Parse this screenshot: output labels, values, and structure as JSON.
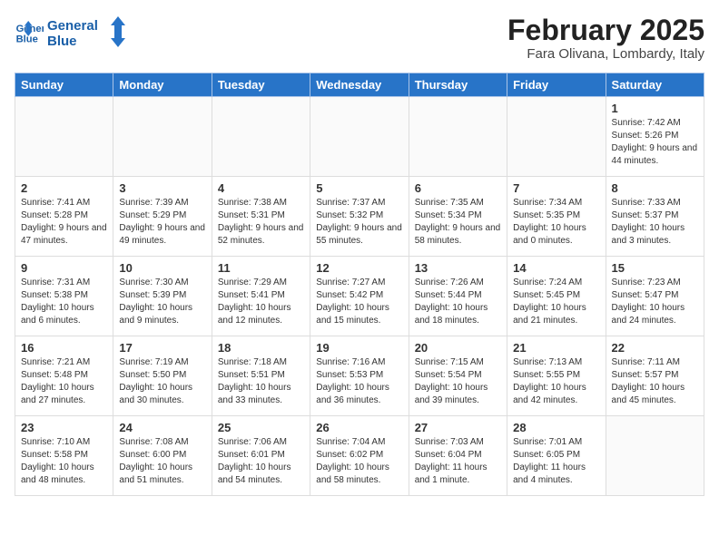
{
  "header": {
    "logo_line1": "General",
    "logo_line2": "Blue",
    "month": "February 2025",
    "location": "Fara Olivana, Lombardy, Italy"
  },
  "weekdays": [
    "Sunday",
    "Monday",
    "Tuesday",
    "Wednesday",
    "Thursday",
    "Friday",
    "Saturday"
  ],
  "weeks": [
    [
      {
        "day": "",
        "info": ""
      },
      {
        "day": "",
        "info": ""
      },
      {
        "day": "",
        "info": ""
      },
      {
        "day": "",
        "info": ""
      },
      {
        "day": "",
        "info": ""
      },
      {
        "day": "",
        "info": ""
      },
      {
        "day": "1",
        "info": "Sunrise: 7:42 AM\nSunset: 5:26 PM\nDaylight: 9 hours and 44 minutes."
      }
    ],
    [
      {
        "day": "2",
        "info": "Sunrise: 7:41 AM\nSunset: 5:28 PM\nDaylight: 9 hours and 47 minutes."
      },
      {
        "day": "3",
        "info": "Sunrise: 7:39 AM\nSunset: 5:29 PM\nDaylight: 9 hours and 49 minutes."
      },
      {
        "day": "4",
        "info": "Sunrise: 7:38 AM\nSunset: 5:31 PM\nDaylight: 9 hours and 52 minutes."
      },
      {
        "day": "5",
        "info": "Sunrise: 7:37 AM\nSunset: 5:32 PM\nDaylight: 9 hours and 55 minutes."
      },
      {
        "day": "6",
        "info": "Sunrise: 7:35 AM\nSunset: 5:34 PM\nDaylight: 9 hours and 58 minutes."
      },
      {
        "day": "7",
        "info": "Sunrise: 7:34 AM\nSunset: 5:35 PM\nDaylight: 10 hours and 0 minutes."
      },
      {
        "day": "8",
        "info": "Sunrise: 7:33 AM\nSunset: 5:37 PM\nDaylight: 10 hours and 3 minutes."
      }
    ],
    [
      {
        "day": "9",
        "info": "Sunrise: 7:31 AM\nSunset: 5:38 PM\nDaylight: 10 hours and 6 minutes."
      },
      {
        "day": "10",
        "info": "Sunrise: 7:30 AM\nSunset: 5:39 PM\nDaylight: 10 hours and 9 minutes."
      },
      {
        "day": "11",
        "info": "Sunrise: 7:29 AM\nSunset: 5:41 PM\nDaylight: 10 hours and 12 minutes."
      },
      {
        "day": "12",
        "info": "Sunrise: 7:27 AM\nSunset: 5:42 PM\nDaylight: 10 hours and 15 minutes."
      },
      {
        "day": "13",
        "info": "Sunrise: 7:26 AM\nSunset: 5:44 PM\nDaylight: 10 hours and 18 minutes."
      },
      {
        "day": "14",
        "info": "Sunrise: 7:24 AM\nSunset: 5:45 PM\nDaylight: 10 hours and 21 minutes."
      },
      {
        "day": "15",
        "info": "Sunrise: 7:23 AM\nSunset: 5:47 PM\nDaylight: 10 hours and 24 minutes."
      }
    ],
    [
      {
        "day": "16",
        "info": "Sunrise: 7:21 AM\nSunset: 5:48 PM\nDaylight: 10 hours and 27 minutes."
      },
      {
        "day": "17",
        "info": "Sunrise: 7:19 AM\nSunset: 5:50 PM\nDaylight: 10 hours and 30 minutes."
      },
      {
        "day": "18",
        "info": "Sunrise: 7:18 AM\nSunset: 5:51 PM\nDaylight: 10 hours and 33 minutes."
      },
      {
        "day": "19",
        "info": "Sunrise: 7:16 AM\nSunset: 5:53 PM\nDaylight: 10 hours and 36 minutes."
      },
      {
        "day": "20",
        "info": "Sunrise: 7:15 AM\nSunset: 5:54 PM\nDaylight: 10 hours and 39 minutes."
      },
      {
        "day": "21",
        "info": "Sunrise: 7:13 AM\nSunset: 5:55 PM\nDaylight: 10 hours and 42 minutes."
      },
      {
        "day": "22",
        "info": "Sunrise: 7:11 AM\nSunset: 5:57 PM\nDaylight: 10 hours and 45 minutes."
      }
    ],
    [
      {
        "day": "23",
        "info": "Sunrise: 7:10 AM\nSunset: 5:58 PM\nDaylight: 10 hours and 48 minutes."
      },
      {
        "day": "24",
        "info": "Sunrise: 7:08 AM\nSunset: 6:00 PM\nDaylight: 10 hours and 51 minutes."
      },
      {
        "day": "25",
        "info": "Sunrise: 7:06 AM\nSunset: 6:01 PM\nDaylight: 10 hours and 54 minutes."
      },
      {
        "day": "26",
        "info": "Sunrise: 7:04 AM\nSunset: 6:02 PM\nDaylight: 10 hours and 58 minutes."
      },
      {
        "day": "27",
        "info": "Sunrise: 7:03 AM\nSunset: 6:04 PM\nDaylight: 11 hours and 1 minute."
      },
      {
        "day": "28",
        "info": "Sunrise: 7:01 AM\nSunset: 6:05 PM\nDaylight: 11 hours and 4 minutes."
      },
      {
        "day": "",
        "info": ""
      }
    ]
  ]
}
